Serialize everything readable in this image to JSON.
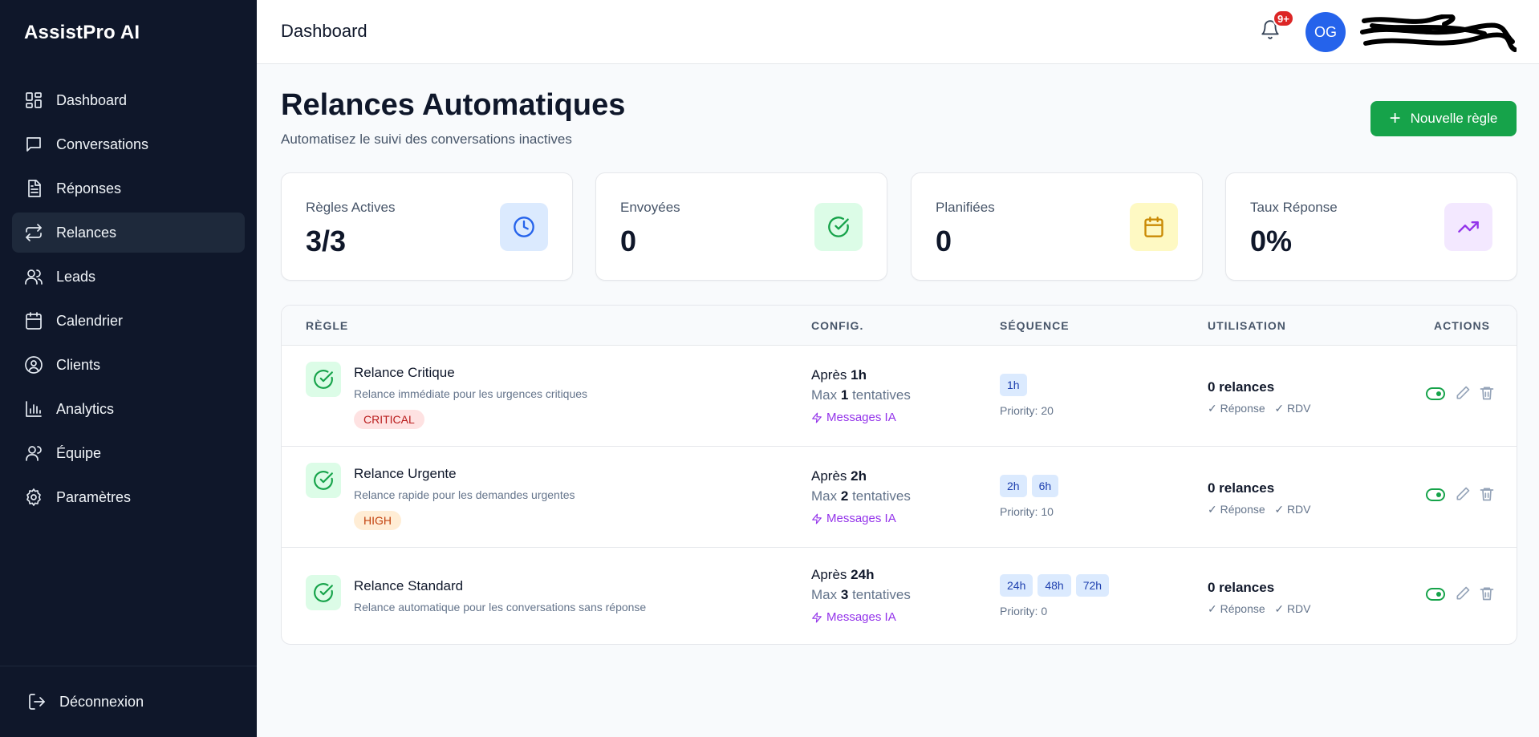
{
  "app": {
    "name": "AssistPro AI"
  },
  "sidebar": {
    "items": [
      {
        "label": "Dashboard",
        "icon": "grid-icon"
      },
      {
        "label": "Conversations",
        "icon": "chat-icon"
      },
      {
        "label": "Réponses",
        "icon": "document-icon"
      },
      {
        "label": "Relances",
        "icon": "repeat-icon",
        "active": true
      },
      {
        "label": "Leads",
        "icon": "users-icon"
      },
      {
        "label": "Calendrier",
        "icon": "calendar-icon"
      },
      {
        "label": "Clients",
        "icon": "user-circle-icon"
      },
      {
        "label": "Analytics",
        "icon": "bar-chart-icon"
      },
      {
        "label": "Équipe",
        "icon": "team-icon"
      },
      {
        "label": "Paramètres",
        "icon": "gear-icon"
      }
    ],
    "logout_label": "Déconnexion"
  },
  "header": {
    "title": "Dashboard",
    "notification_count": "9+",
    "avatar_initials": "OG"
  },
  "page": {
    "title": "Relances Automatiques",
    "subtitle": "Automatisez le suivi des conversations inactives",
    "new_rule_label": "Nouvelle règle"
  },
  "stats": [
    {
      "label": "Règles Actives",
      "value": "3/3",
      "icon": "clock-icon",
      "accent": "#2563eb",
      "bg": "#dbeafe"
    },
    {
      "label": "Envoyées",
      "value": "0",
      "icon": "check-circle-icon",
      "accent": "#16a34a",
      "bg": "#dcfce7"
    },
    {
      "label": "Planifiées",
      "value": "0",
      "icon": "calendar-icon",
      "accent": "#ca8a04",
      "bg": "#fef9c3"
    },
    {
      "label": "Taux Réponse",
      "value": "0%",
      "icon": "trending-up-icon",
      "accent": "#9333ea",
      "bg": "#f3e8ff"
    }
  ],
  "table": {
    "headers": [
      "RÈGLE",
      "CONFIG.",
      "SÉQUENCE",
      "UTILISATION",
      "ACTIONS"
    ],
    "rows": [
      {
        "name": "Relance Critique",
        "description": "Relance immédiate pour les urgences critiques",
        "priority_tag": "CRITICAL",
        "priority_tag_bg": "#fee2e2",
        "priority_tag_color": "#b91c1c",
        "after_prefix": "Après",
        "after_value": "1h",
        "max_prefix": "Max",
        "max_value": "1",
        "max_suffix": "tentatives",
        "ai_label": "Messages IA",
        "sequence": [
          "1h"
        ],
        "priority_text": "Priority: 20",
        "usage": "0 relances",
        "usage_checks": "✓ Réponse   ✓ RDV",
        "enabled": true
      },
      {
        "name": "Relance Urgente",
        "description": "Relance rapide pour les demandes urgentes",
        "priority_tag": "HIGH",
        "priority_tag_bg": "#ffedd5",
        "priority_tag_color": "#c2410c",
        "after_prefix": "Après",
        "after_value": "2h",
        "max_prefix": "Max",
        "max_value": "2",
        "max_suffix": "tentatives",
        "ai_label": "Messages IA",
        "sequence": [
          "2h",
          "6h"
        ],
        "priority_text": "Priority: 10",
        "usage": "0 relances",
        "usage_checks": "✓ Réponse   ✓ RDV",
        "enabled": true
      },
      {
        "name": "Relance Standard",
        "description": "Relance automatique pour les conversations sans réponse",
        "priority_tag": "",
        "after_prefix": "Après",
        "after_value": "24h",
        "max_prefix": "Max",
        "max_value": "3",
        "max_suffix": "tentatives",
        "ai_label": "Messages IA",
        "sequence": [
          "24h",
          "48h",
          "72h"
        ],
        "priority_text": "Priority: 0",
        "usage": "0 relances",
        "usage_checks": "✓ Réponse   ✓ RDV",
        "enabled": true
      }
    ]
  }
}
